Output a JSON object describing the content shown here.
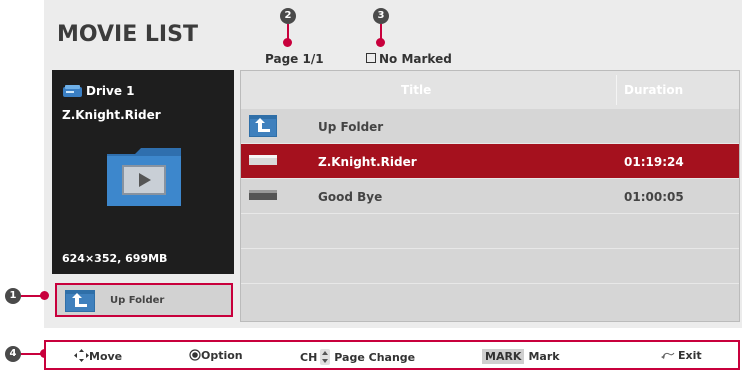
{
  "header": {
    "title": "MOVIE LIST",
    "page": "Page 1/1",
    "marked": "No Marked"
  },
  "callouts": [
    "1",
    "2",
    "3",
    "4"
  ],
  "preview": {
    "drive": "Drive 1",
    "filename": "Z.Knight.Rider",
    "meta": "624×352,  699MB"
  },
  "up_folder_button": {
    "label": "Up Folder"
  },
  "list": {
    "columns": {
      "title": "Title",
      "duration": "Duration"
    },
    "rows": [
      {
        "name": "Up Folder",
        "duration": "",
        "icon": "up-folder-icon",
        "selected": false
      },
      {
        "name": "Z.Knight.Rider",
        "duration": "01:19:24",
        "icon": "video-file-icon",
        "selected": true
      },
      {
        "name": "Good Bye",
        "duration": "01:00:05",
        "icon": "video-file-icon",
        "selected": false
      }
    ]
  },
  "bottom_bar": {
    "move": "Move",
    "option": "Option",
    "ch": "CH",
    "page_change": "Page Change",
    "mark_key": "MARK",
    "mark": "Mark",
    "exit": "Exit"
  },
  "colors": {
    "accent": "#c8003c",
    "selected_row": "#a5111e",
    "preview_bg": "#1e1e1e"
  }
}
